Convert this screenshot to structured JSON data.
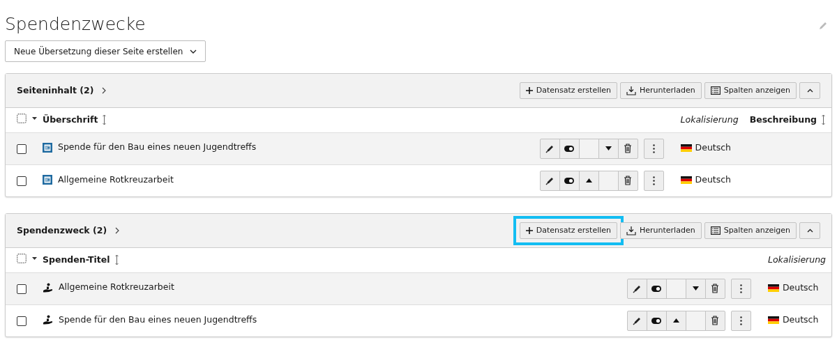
{
  "page": {
    "title": "Spendenzwecke"
  },
  "translation_select": {
    "value": "Neue Übersetzung dieser Seite erstellen"
  },
  "panels": [
    {
      "title": "Seiteninhalt (2)",
      "kind": "content",
      "buttons": [
        {
          "kind": "create",
          "label": "Datensatz erstellen",
          "highlighted": false
        },
        {
          "kind": "download",
          "label": "Herunterladen"
        },
        {
          "kind": "columns",
          "label": "Spalten anzeigen"
        },
        {
          "kind": "collapse"
        }
      ],
      "columns": [
        {
          "label": "Überschrift",
          "kind": "sortable"
        },
        {
          "label": "Lokalisierung",
          "kind": "localization"
        },
        {
          "label": "Beschreibung",
          "kind": "sortable"
        }
      ],
      "rows": [
        {
          "title": "Spende für den Bau eines neuen Jugendtreffs",
          "checked": false,
          "hovered": true,
          "move_up": false,
          "move_down": true,
          "language": "Deutsch"
        },
        {
          "title": "Allgemeine Rotkreuzarbeit",
          "checked": false,
          "hovered": false,
          "move_up": true,
          "move_down": false,
          "language": "Deutsch"
        }
      ]
    },
    {
      "title": "Spendenzweck (2)",
      "kind": "donation",
      "buttons": [
        {
          "kind": "create",
          "label": "Datensatz erstellen",
          "highlighted": true
        },
        {
          "kind": "download",
          "label": "Herunterladen"
        },
        {
          "kind": "columns",
          "label": "Spalten anzeigen"
        },
        {
          "kind": "collapse"
        }
      ],
      "columns": [
        {
          "label": "Spenden-Titel",
          "kind": "sortable"
        },
        {
          "label": "Lokalisierung",
          "kind": "localization"
        }
      ],
      "rows": [
        {
          "title": "Allgemeine Rotkreuzarbeit",
          "checked": false,
          "hovered": true,
          "move_up": false,
          "move_down": true,
          "language": "Deutsch"
        },
        {
          "title": "Spende für den Bau eines neuen Jugendtreffs",
          "checked": false,
          "hovered": false,
          "move_up": true,
          "move_down": false,
          "language": "Deutsch"
        }
      ]
    }
  ]
}
